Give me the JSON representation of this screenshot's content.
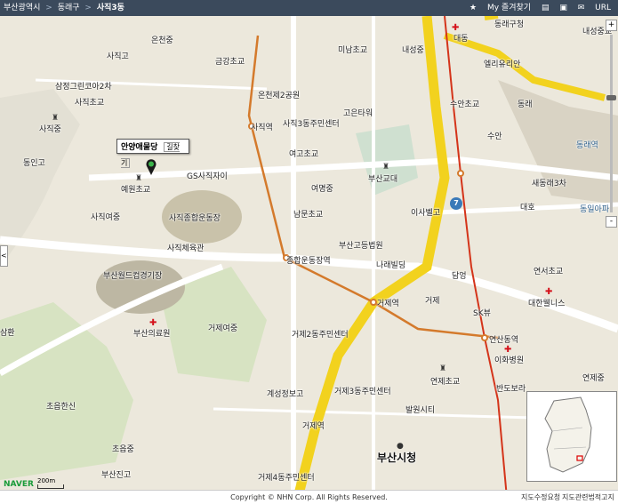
{
  "breadcrumb": {
    "items": [
      "부산광역시",
      "동래구",
      "사직3동"
    ],
    "separator": ">"
  },
  "toolbar": {
    "favorites": "My 즐겨찾기",
    "url": "URL"
  },
  "poi_popup": {
    "name": "안양애물당",
    "route": "길찾기"
  },
  "shield": "7",
  "zoom": {
    "plus": "+",
    "minus": "-",
    "level": 0.35
  },
  "left_tab": "<",
  "labels": {
    "yeonsanjung": "온천중",
    "sajikgo": "사직고",
    "samjeong": "삼정그린코아2차",
    "sajikcho": "사직초교",
    "sajikjung": "사직중",
    "donggo": "동인고",
    "geumgang": "금강초교",
    "oncheon2": "온천제2공원",
    "sajikyeok": "사직역",
    "sajik3ctr": "사직3동주민센터",
    "minam": "미남초교",
    "naeseong": "내성중",
    "gomun": "고은타워",
    "yeogo": "여고초교",
    "busanedu": "부산교대",
    "yeomyeong": "여명중",
    "nammun": "남문초교",
    "isabel": "이사벨고",
    "court": "부산고등법원",
    "naraview": "나래빌딩",
    "yewon": "예원초교",
    "gs": "GS사직자이",
    "sajikwon": "사직여중",
    "stadium": "사직종합운동장",
    "gym": "사직체육관",
    "worldcup": "부산월드컵경기장",
    "jonghap": "종합운동장역",
    "geojeyeok": "거제역",
    "geojeyeok2": "거제역",
    "geoje": "거제",
    "damyeong": "담엉",
    "skview": "SK뷰",
    "busanhosp": "부산의료원",
    "geojegirl": "거제여중",
    "geoje2ctr": "거제2동주민센터",
    "yeonsanstn": "연산동역",
    "ehwa": "이화병원",
    "yeonje": "연제초교",
    "banbo": "반도보라",
    "geoje3ctr": "거제3동주민센터",
    "balwon": "발원시티",
    "gyeseong": "계성정보고",
    "geojestn": "거제역",
    "cityhall": "부산시청",
    "choeup": "초읍한신",
    "choeupjung": "초읍중",
    "busanjin": "부산진고",
    "geoje4ctr": "거제4동주민센터",
    "samho": "삼환",
    "dongnae": "동래구청",
    "daedong": "대동",
    "allelu": "엘리유리안",
    "suan": "수안초교",
    "dongrae": "동래",
    "suan2": "수안",
    "dongraeyeok": "동래역",
    "saedong3": "새동래3차",
    "daeho": "대호",
    "dongil": "동일아파",
    "yeonseo": "연서초교",
    "daehan": "대한웰니스",
    "naeseongjung": "내성중교",
    "yeonsanjung2": "연산중",
    "yeonjestn": "연제중"
  },
  "scale_label": "200m",
  "logo": "NAVER",
  "copyright": "Copyright © NHN Corp. All Rights Reserved.",
  "bottom_links": [
    "지도수정요청",
    "지도관련법적고지"
  ],
  "colors": {
    "highway": "#f2d21e",
    "arterial": "#ffffff",
    "rail": "#d47a2c",
    "water": "#c9d6e3",
    "park": "#d7e3c2"
  }
}
